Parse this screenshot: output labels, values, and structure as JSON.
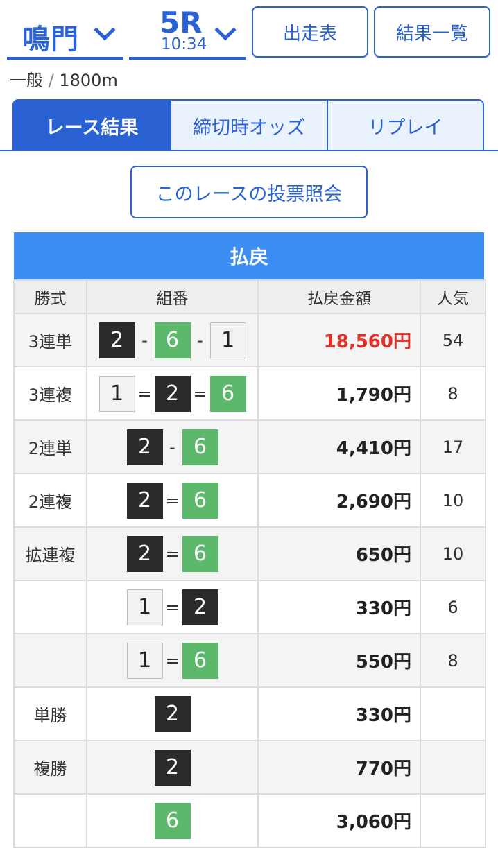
{
  "header": {
    "venue": "鳴門",
    "race": "5R",
    "time": "10:34",
    "btn_entries": "出走表",
    "btn_results": "結果一覧"
  },
  "subinfo": {
    "grade": "一般",
    "sep": "/",
    "distance": "1800m"
  },
  "tabs": [
    "レース結果",
    "締切時オッズ",
    "リプレイ"
  ],
  "active_tab": 0,
  "vote_button": "このレースの投票照会",
  "payout": {
    "title": "払戻",
    "headers": [
      "勝式",
      "組番",
      "払戻金額",
      "人気"
    ],
    "rows": [
      {
        "type": "3連単",
        "amount": "18,560円",
        "pop": "54"
      },
      {
        "type": "3連複",
        "amount": "1,790円",
        "pop": "8"
      },
      {
        "type": "2連単",
        "amount": "4,410円",
        "pop": "17"
      },
      {
        "type": "2連複",
        "amount": "2,690円",
        "pop": "10"
      },
      {
        "type": "拡連複",
        "amount": "650円",
        "pop": "10"
      },
      {
        "type": "",
        "amount": "330円",
        "pop": "6"
      },
      {
        "type": "",
        "amount": "550円",
        "pop": "8"
      },
      {
        "type": "単勝",
        "amount": "330円",
        "pop": ""
      },
      {
        "type": "複勝",
        "amount": "770円",
        "pop": ""
      },
      {
        "type": "",
        "amount": "3,060円",
        "pop": ""
      }
    ],
    "combos": [
      [
        {
          "n": "2",
          "c": "k"
        },
        {
          "s": "-"
        },
        {
          "n": "6",
          "c": "g"
        },
        {
          "s": "-"
        },
        {
          "n": "1",
          "c": "w"
        }
      ],
      [
        {
          "n": "1",
          "c": "w"
        },
        {
          "s": "="
        },
        {
          "n": "2",
          "c": "k"
        },
        {
          "s": "="
        },
        {
          "n": "6",
          "c": "g"
        }
      ],
      [
        {
          "n": "2",
          "c": "k"
        },
        {
          "s": "-"
        },
        {
          "n": "6",
          "c": "g"
        }
      ],
      [
        {
          "n": "2",
          "c": "k"
        },
        {
          "s": "="
        },
        {
          "n": "6",
          "c": "g"
        }
      ],
      [
        {
          "n": "2",
          "c": "k"
        },
        {
          "s": "="
        },
        {
          "n": "6",
          "c": "g"
        }
      ],
      [
        {
          "n": "1",
          "c": "w"
        },
        {
          "s": "="
        },
        {
          "n": "2",
          "c": "k"
        }
      ],
      [
        {
          "n": "1",
          "c": "w"
        },
        {
          "s": "="
        },
        {
          "n": "6",
          "c": "g"
        }
      ],
      [
        {
          "n": "2",
          "c": "k"
        }
      ],
      [
        {
          "n": "2",
          "c": "k"
        }
      ],
      [
        {
          "n": "6",
          "c": "g"
        }
      ]
    ]
  },
  "colors": {
    "accent": "#2a62d3",
    "header_bar": "#3d8ef2",
    "boat_black": "#2b2b2b",
    "boat_green": "#5cb86b",
    "highlight_red": "#e0322a"
  }
}
